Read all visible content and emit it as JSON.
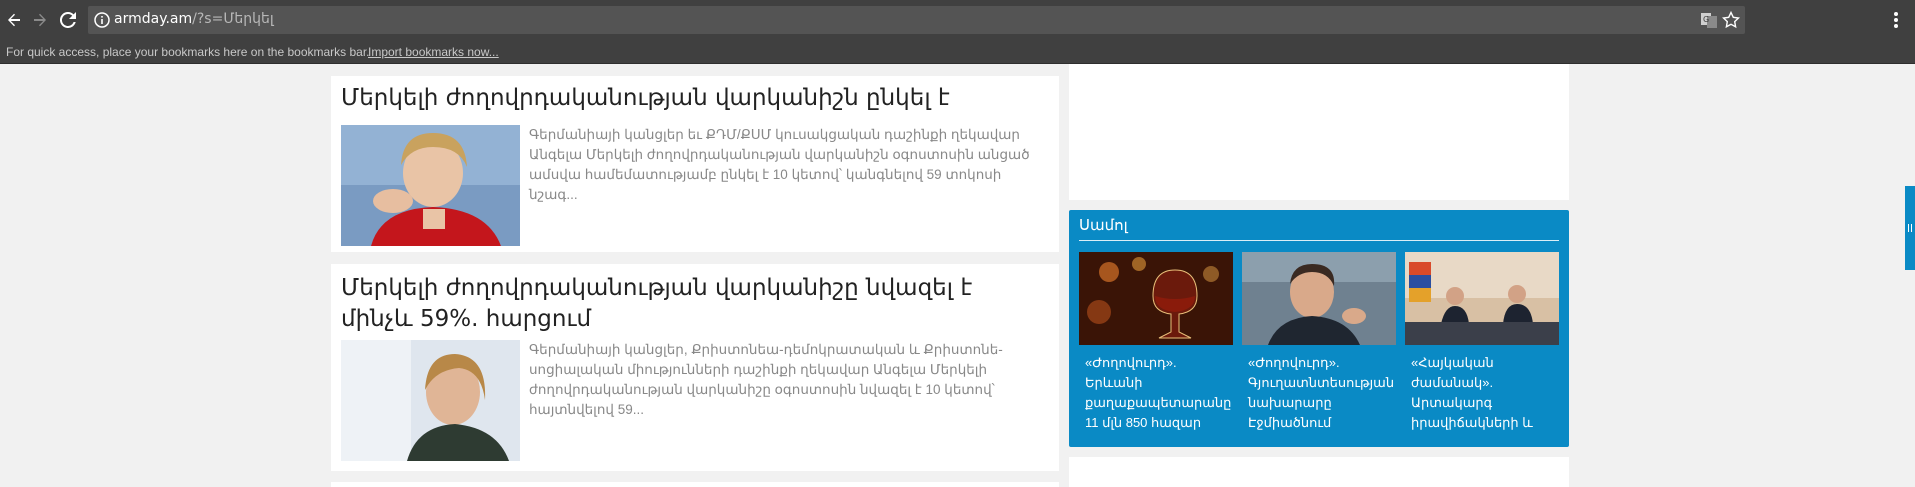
{
  "browser": {
    "url_host": "armday.am",
    "url_path": "/?s=Մերկել",
    "bookmarks_message": "For quick access, place your bookmarks here on the bookmarks bar.",
    "import_link": "Import bookmarks now..."
  },
  "articles": [
    {
      "title": "Մերկելի ժողովրդականության վարկանիշն ընկել է",
      "excerpt": "Գերմանիայի կանցլեր եւ ՔԴՄ/ՔՍՄ կուսակցական դաշինքի ղեկավար Անգելա Մերկելի ժողովրդականության վարկանիշն օգոստոսին անցած ամսվա համեմատությամբ ընկել է 10 կետով՝ կանգնելով 59 տոկոսի նշագ..."
    },
    {
      "title": "Մերկելի ժողովրդականության վարկանիշը նվազել է մինչև 59%. հարցում",
      "excerpt": "Գերմանիայի կանցլեր, Քրիստոնեա-դեմոկրատական և Քրիստոնե-սոցիալական միությունների դաշինքի ղեկավար Անգելա Մերկելի ժողովրդականության վարկանիշը օգոստոսին նվազել է 10 կետով՝ հայտնվելով 59..."
    }
  ],
  "sidebar": {
    "section_title": "Սամոլ",
    "items": [
      {
        "caption": "«Ժողովուրդ». Երևանի քաղաքապետարանը 11 մլն 850 հազար"
      },
      {
        "caption": "«Ժողովուրդ». Գյուղատնտեսության նախարարը Էջմիածնում"
      },
      {
        "caption": "«Հայկական ժամանակ». Արտակարգ իրավիճակների և"
      }
    ]
  },
  "colors": {
    "accent": "#0a8ac5",
    "toolbar": "#404040",
    "omnibox": "#545454"
  }
}
